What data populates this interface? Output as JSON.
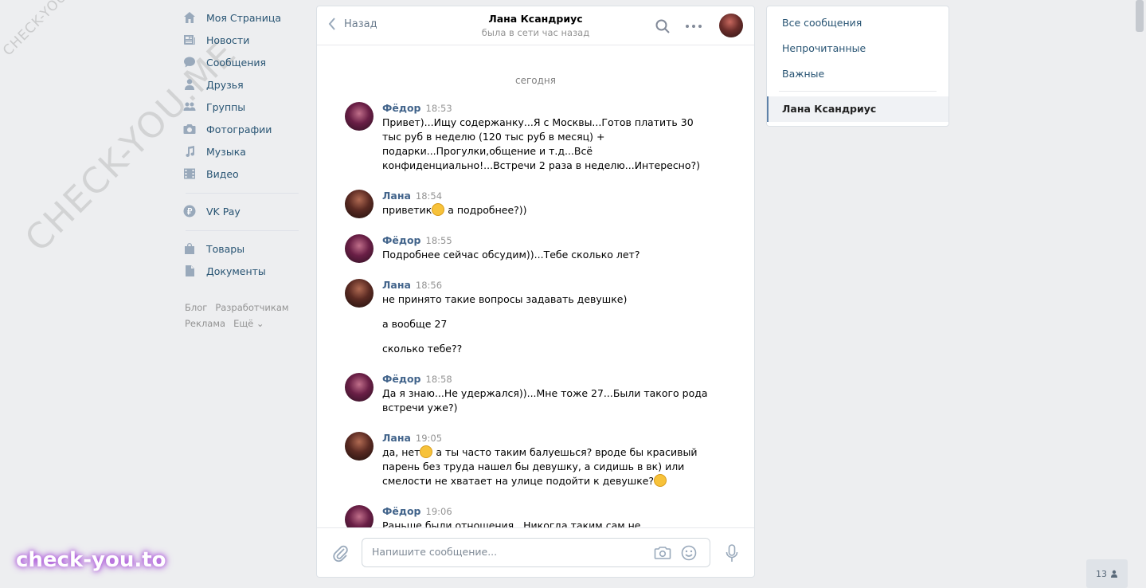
{
  "leftnav": {
    "items": [
      {
        "label": "Моя Страница",
        "icon": "home-icon"
      },
      {
        "label": "Новости",
        "icon": "news-icon"
      },
      {
        "label": "Сообщения",
        "icon": "messages-icon"
      },
      {
        "label": "Друзья",
        "icon": "friends-icon"
      },
      {
        "label": "Группы",
        "icon": "groups-icon"
      },
      {
        "label": "Фотографии",
        "icon": "camera-icon"
      },
      {
        "label": "Музыка",
        "icon": "music-icon"
      },
      {
        "label": "Видео",
        "icon": "video-icon"
      }
    ],
    "vkpay": "VK Pay",
    "extra": [
      {
        "label": "Товары",
        "icon": "shopping-bag-icon"
      },
      {
        "label": "Документы",
        "icon": "document-icon"
      }
    ],
    "footer": {
      "blog": "Блог",
      "dev": "Разработчикам",
      "ads": "Реклама",
      "more": "Ещё ⌄"
    }
  },
  "watermark": {
    "small": "CHECK-YOU.ME",
    "big": "CHECK-YOU.ME",
    "badge": "check-you.to"
  },
  "chat": {
    "back": "Назад",
    "peer_name": "Лана Ксандриус",
    "peer_status": "была в сети час назад",
    "day": "сегодня",
    "messages": [
      {
        "author": "Фёдор",
        "time": "18:53",
        "lines": [
          "Привет)...Ищу содержанку...Я с Москвы...Готов платить 30",
          "тыс руб в неделю (120 тыс руб в месяц) +",
          "подарки...Прогулки,общение и т.д...Всё",
          "конфиденциально!...Встречи 2 раза в неделю...Интересно?)"
        ]
      },
      {
        "author": "Лана",
        "time": "18:54",
        "text_a": "приветик",
        "text_b": " а подробнее?))"
      },
      {
        "author": "Фёдор",
        "time": "18:55",
        "text": "Подробнее сейчас обсудим))...Тебе сколько лет?"
      },
      {
        "author": "Лана",
        "time": "18:56",
        "texts": [
          "не принято такие вопросы задавать девушке)",
          "а вообще 27",
          "сколько тебе??"
        ]
      },
      {
        "author": "Фёдор",
        "time": "18:58",
        "lines": [
          "Да я знаю...Не удержался))...Мне тоже 27...Были такого рода",
          "встречи уже?)"
        ]
      },
      {
        "author": "Лана",
        "time": "19:05",
        "line1a": "да, нет",
        "line1b": " а ты часто таким балуешься? вроде бы красивый",
        "line2": "парень без труда нашел бы девушку, а сидишь в вк) или",
        "line3": "смелости не хватает на улице подойти к девушке?"
      },
      {
        "author": "Фёдор",
        "time": "19:06",
        "text": "Раньше были отношения...Никогда таким сам не"
      }
    ],
    "input_placeholder": "Напишите сообщение..."
  },
  "rightnav": {
    "all": "Все сообщения",
    "unread": "Непрочитанные",
    "important": "Важные",
    "active": "Лана Ксандриус"
  },
  "online_count": "13"
}
